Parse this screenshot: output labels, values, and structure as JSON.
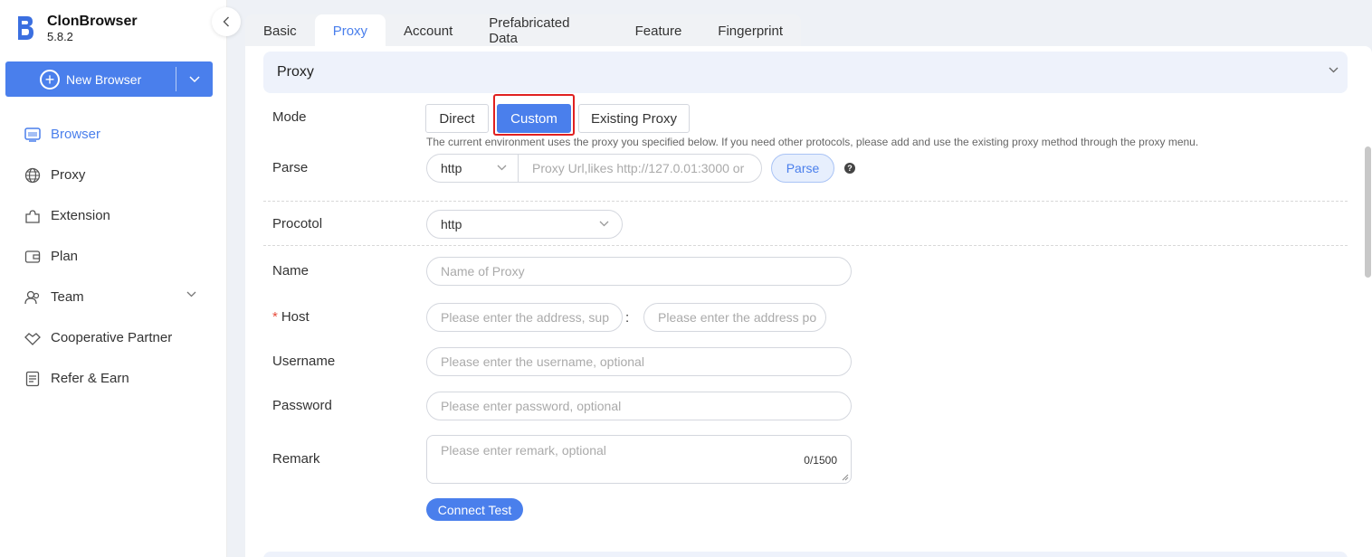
{
  "app": {
    "name": "ClonBrowser",
    "version": "5.8.2"
  },
  "new_browser": {
    "label": "New Browser"
  },
  "sidebar": {
    "items": [
      {
        "label": "Browser",
        "icon": "browser-icon",
        "active": true
      },
      {
        "label": "Proxy",
        "icon": "globe-icon"
      },
      {
        "label": "Extension",
        "icon": "puzzle-icon"
      },
      {
        "label": "Plan",
        "icon": "wallet-icon"
      },
      {
        "label": "Team",
        "icon": "team-icon",
        "has_chevron": true
      },
      {
        "label": "Cooperative Partner",
        "icon": "handshake-icon"
      },
      {
        "label": "Refer & Earn",
        "icon": "document-icon"
      }
    ]
  },
  "tabs": [
    "Basic",
    "Proxy",
    "Account",
    "Prefabricated Data",
    "Feature",
    "Fingerprint"
  ],
  "active_tab": "Proxy",
  "section": {
    "title": "Proxy"
  },
  "form": {
    "mode": {
      "label": "Mode",
      "options": [
        "Direct",
        "Custom",
        "Existing Proxy"
      ],
      "selected": "Custom",
      "hint": "The current environment uses the proxy you specified below. If you need other protocols, please add and use the existing proxy method through the proxy menu."
    },
    "parse": {
      "label": "Parse",
      "protocol": "http",
      "placeholder": "Proxy Url,likes http://127.0.01:3000 or",
      "button": "Parse"
    },
    "protocol": {
      "label": "Procotol",
      "value": "http"
    },
    "name": {
      "label": "Name",
      "placeholder": "Name of Proxy"
    },
    "host": {
      "label": "Host",
      "required_mark": "*",
      "address_placeholder": "Please enter the address, sup",
      "separator": ":",
      "port_placeholder": "Please enter the address po"
    },
    "username": {
      "label": "Username",
      "placeholder": "Please enter the username, optional"
    },
    "password": {
      "label": "Password",
      "placeholder": "Please enter password, optional"
    },
    "remark": {
      "label": "Remark",
      "placeholder": "Please enter remark, optional",
      "counter": "0/1500"
    },
    "connect_test": "Connect Test"
  },
  "colors": {
    "accent": "#4a7fec",
    "highlight_border": "#e02020"
  }
}
